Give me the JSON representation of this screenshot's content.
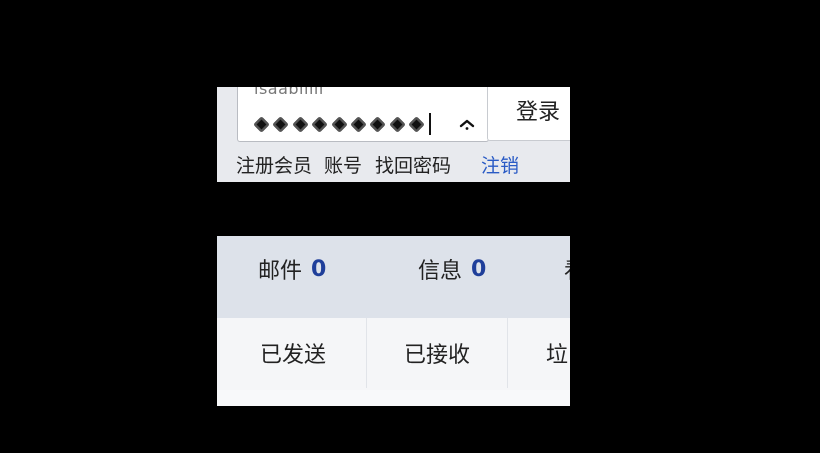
{
  "login": {
    "username": "isaabiiiii",
    "password_mask_count": 9,
    "login_button": "登录",
    "links": {
      "register": "注册会员",
      "account": "账号",
      "recover_password": "找回密码",
      "logout": "注销"
    },
    "icons": {
      "toggle": "chevron-up-icon"
    }
  },
  "mail": {
    "counts": [
      {
        "label": "邮件",
        "value": "0"
      },
      {
        "label": "信息",
        "value": "0"
      }
    ],
    "cut_char": "看",
    "folders": [
      {
        "label": "已发送"
      },
      {
        "label": "已接收"
      },
      {
        "label": "垃"
      }
    ]
  },
  "colors": {
    "background": "#000000",
    "panel": "#e8eaee",
    "count_bar": "#dde2ea",
    "count_number": "#1f3f9a",
    "link_accent": "#2a5bc5"
  }
}
